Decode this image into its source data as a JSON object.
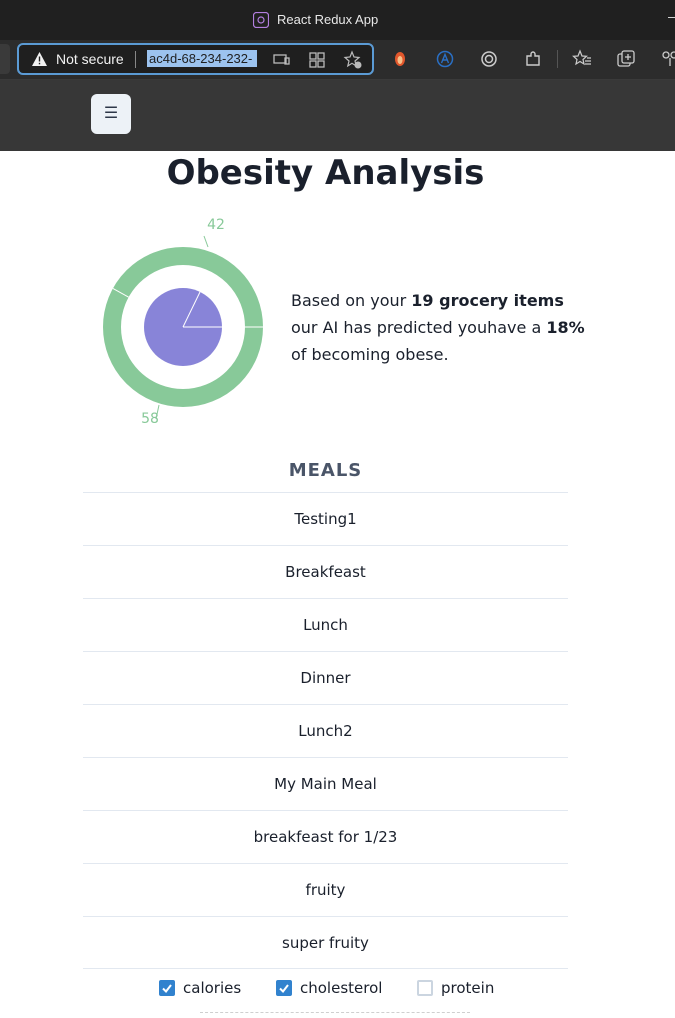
{
  "browser": {
    "window_title": "React Redux App",
    "security_label": "Not secure",
    "url": "ac4d-68-234-232-"
  },
  "page": {
    "title": "Obesity Analysis"
  },
  "analysis": {
    "donut": {
      "outer_labels": [
        "42",
        "58"
      ],
      "outer_values": [
        42,
        58
      ],
      "outer_color": "#88c999",
      "inner_color": "#8884d8"
    },
    "summary": {
      "prefix": "Based on your ",
      "items_count_text": "19 grocery items",
      "middle": " our AI has predicted youhave a ",
      "percent_text": "18%",
      "suffix": " of becoming obese."
    }
  },
  "meals": {
    "heading": "MEALS",
    "items": [
      "Testing1",
      "Breakfeast",
      "Lunch",
      "Dinner",
      "Lunch2",
      "My Main Meal",
      "breakfeast for 1/23",
      "fruity",
      "super fruity"
    ]
  },
  "nutrient_filters": [
    {
      "label": "calories",
      "checked": true
    },
    {
      "label": "cholesterol",
      "checked": true
    },
    {
      "label": "protein",
      "checked": false
    }
  ],
  "colors": {
    "accent": "#3182ce",
    "header_bg": "#373737",
    "donut_outer": "#88c999",
    "donut_inner": "#8884d8"
  }
}
